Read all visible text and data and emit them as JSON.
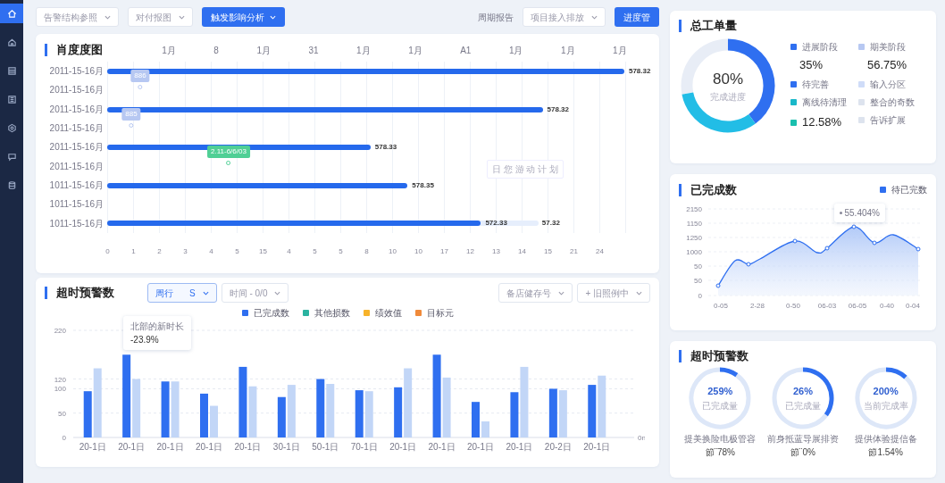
{
  "sidebar": {
    "items": [
      {
        "selected": true
      },
      {
        "selected": false
      },
      {
        "selected": false
      },
      {
        "selected": false
      },
      {
        "selected": false
      },
      {
        "selected": false
      },
      {
        "selected": false
      }
    ]
  },
  "toolbar": {
    "selects": [
      {
        "placeholder": "告警结构参照"
      },
      {
        "placeholder": "对付报图"
      }
    ],
    "primary_button": "触发影响分析",
    "period_label": "周期报告",
    "period_select": "项目接入排放",
    "action_button": "进度管"
  },
  "gantt": {
    "title": "肖度度图",
    "top_axis": [
      "1月",
      "8",
      "1月",
      "31",
      "1月",
      "1月",
      "A1",
      "1月",
      "1月",
      "1月"
    ],
    "rows": [
      {
        "label": "2011-15-16月",
        "bar": {
          "level": 0.988,
          "value": "578.32"
        }
      },
      {
        "label": "2011-15-16月",
        "pin": {
          "level": 0.063,
          "text": "886",
          "color": "#b7c8f2"
        }
      },
      {
        "label": "2011-15-16月",
        "bar": {
          "level": 0.832,
          "value": "578.32"
        }
      },
      {
        "label": "2011-15-16月",
        "pin": {
          "level": 0.046,
          "text": "885",
          "color": "#b7c8f2"
        }
      },
      {
        "label": "2011-15-16月",
        "bar": {
          "level": 0.503,
          "value": "578.33"
        }
      },
      {
        "label": "2011-15-16月",
        "pin": {
          "level": 0.232,
          "text": "2.11-6/6/03",
          "color": "#4fcf95"
        }
      },
      {
        "label": "1011-15-16月",
        "bar": {
          "level": 0.574,
          "value": "578.35"
        }
      },
      {
        "label": "1011-15-16月"
      },
      {
        "label": "1011-15-16月",
        "bar": {
          "level": 0.714,
          "value": "572.33"
        },
        "secondary": {
          "level": 0.824,
          "value": "57.32"
        }
      }
    ],
    "note": "日 您 游 动 计 划",
    "x_ticks": [
      "0",
      "1",
      "2",
      "3",
      "4",
      "5",
      "15",
      "4",
      "5",
      "5",
      "8",
      "10",
      "10",
      "17",
      "12",
      "13",
      "14",
      "15",
      "21",
      "24"
    ]
  },
  "alerts": {
    "title": "超时预警数",
    "filters": [
      {
        "label": "周行",
        "value": "S",
        "selected": true
      },
      {
        "label": "时间 - 0/0",
        "selected": false
      }
    ],
    "right_filters": [
      "备店健存号",
      "+ 旧照例中"
    ],
    "legend": [
      {
        "label": "已完成数",
        "color": "#2f6ff0"
      },
      {
        "label": "其他损数",
        "color": "#2bb3a0"
      },
      {
        "label": "绩效值",
        "color": "#f7b32b"
      },
      {
        "label": "目标元",
        "color": "#f08a3a"
      }
    ],
    "tooltip": {
      "title": "北部的新时长",
      "value": "-23.9%"
    },
    "unit": "0n",
    "chart_data": {
      "type": "bar",
      "categories": [
        "20-1日",
        "20-1日",
        "20-1日",
        "20-1日",
        "20-1日",
        "30-1日",
        "50-1日",
        "70-1日",
        "20-1日",
        "20-1日",
        "20-1日",
        "20-1日",
        "20-2日",
        "20-1日"
      ],
      "series": [
        {
          "color": "#2f6ff0",
          "values": [
            95,
            170,
            115,
            90,
            145,
            83,
            120,
            97,
            103,
            170,
            73,
            93,
            100,
            108
          ]
        },
        {
          "color": "#c2d6f7",
          "values": [
            142,
            120,
            115,
            65,
            105,
            108,
            110,
            95,
            142,
            123,
            33,
            145,
            97,
            127
          ]
        }
      ],
      "ylim": [
        0,
        220
      ],
      "yticks": [
        0,
        50,
        100,
        120,
        220
      ],
      "grid": true
    }
  },
  "total": {
    "title": "总工单量",
    "donut": {
      "center": "80%",
      "caption": "完成进度",
      "segments": [
        {
          "color": "#2f6ff0"
        },
        {
          "color": "#22bde6"
        }
      ]
    },
    "legend": [
      {
        "color": "#2f6ff0",
        "label": "进展阶段",
        "value": "35%"
      },
      {
        "color": "#b7c8f2",
        "label": "期美阶段",
        "value": "56.75%"
      },
      {
        "color": "#2f6ff0",
        "label": "待完善"
      },
      {
        "color": "#cfdcf8",
        "label": "输入分区"
      },
      {
        "color": "#19b8c9",
        "label": "离线待清理"
      },
      {
        "color": "#dde3ee",
        "label": "整合的奇数"
      },
      {
        "color": "#19bfae",
        "label": "12.58%",
        "kind": "value"
      },
      {
        "color": "#dde3ee",
        "label": "告诉扩展"
      }
    ]
  },
  "done": {
    "title": "已完成数",
    "legend": "待已完数",
    "y_labels": [
      "2150",
      "1150",
      "1250",
      "1000",
      "50",
      "50",
      "0"
    ],
    "x_labels": [
      "0-05",
      "2-28",
      "0-50",
      "06-03",
      "06-05",
      "0-40",
      "0-04"
    ],
    "tooltip": "55.404%"
  },
  "gauges": {
    "title": "超时预警数",
    "items": [
      {
        "value": "259%",
        "caption": "已完成量",
        "label": "提美换险电极管容",
        "delta": "節¨78%"
      },
      {
        "value": "26%",
        "caption": "已完成量",
        "label": "前身抵蓝导展排资",
        "delta": "節¨0%"
      },
      {
        "value": "200%",
        "caption": "当前完成率",
        "label": "提供体验提信备",
        "delta": "節1.54%"
      }
    ]
  }
}
